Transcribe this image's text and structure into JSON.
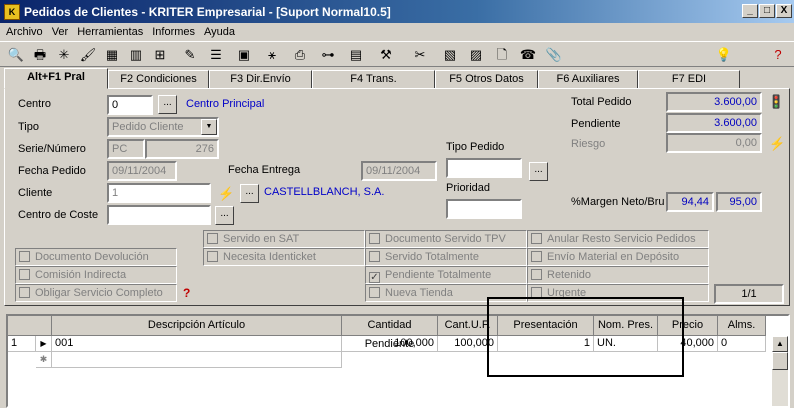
{
  "window": {
    "title": "Pedidos de Clientes - KRITER Empresarial - [Suport Normal10.5]",
    "controls": [
      "_",
      "□",
      "X"
    ]
  },
  "menu": [
    "Archivo",
    "Ver",
    "Herramientas",
    "Informes",
    "Ayuda"
  ],
  "tabs": [
    "Alt+F1 Pral",
    "F2 Condiciones",
    "F3 Dir.Envío",
    "F4 Trans.",
    "F5 Otros Datos",
    "F6 Auxiliares",
    "F7 EDI"
  ],
  "form": {
    "centro_label": "Centro",
    "centro_value": "0",
    "centro_name": "Centro Principal",
    "tipo_label": "Tipo",
    "tipo_value": "Pedido Cliente",
    "serie_label": "Serie/Número",
    "serie_value": "PC",
    "numero_value": "276",
    "fecha_pedido_label": "Fecha Pedido",
    "fecha_pedido_value": "09/11/2004",
    "fecha_entrega_label": "Fecha Entrega",
    "fecha_entrega_value": "09/11/2004",
    "tipo_pedido_label": "Tipo Pedido",
    "tipo_pedido_value": "",
    "prioridad_label": "Prioridad",
    "prioridad_value": "",
    "cliente_label": "Cliente",
    "cliente_value": "1",
    "cliente_name": "CASTELLBLANCH, S.A.",
    "centro_coste_label": "Centro de Coste",
    "centro_coste_value": "",
    "ellipsis": "...",
    "dropdown_arrow": "▼"
  },
  "totals": {
    "total_label": "Total Pedido",
    "total_value": "3.600,00",
    "pendiente_label": "Pendiente",
    "pendiente_value": "3.600,00",
    "riesgo_label": "Riesgo",
    "riesgo_value": "0,00",
    "margen_label": "%Margen Neto/Bru",
    "margen_neto": "94,44",
    "margen_bruto": "95,00"
  },
  "checkboxes": {
    "col1": [
      "Documento Devolución",
      "Comisión Indirecta",
      "Obligar Servicio Completo"
    ],
    "col2": [
      "Servido en SAT",
      "Necesita Identicket"
    ],
    "col3": [
      "Documento Servido TPV",
      "Servido Totalmente",
      "Pendiente Totalmente",
      "Nueva Tienda"
    ],
    "col3_checked": [
      false,
      false,
      true,
      false
    ],
    "col4": [
      "Anular Resto Servicio Pedidos",
      "Envío Material en Depósito",
      "Retenido",
      "Urgente"
    ],
    "check_mark": "✓"
  },
  "page_indicator": "1/1",
  "grid": {
    "headers": [
      "",
      "Descripción Artículo",
      "Cantidad Pendiente",
      "Cant.U.F.",
      "Presentación",
      "Nom. Pres.",
      "Precio",
      "Alms."
    ],
    "rows": [
      {
        "num": "1",
        "marker": "▶",
        "desc": "001",
        "cant_pend": "100,000",
        "cant_uf": "100,000",
        "pres": "1",
        "nom_pres": "UN.",
        "precio": "40,000",
        "alms": "0"
      }
    ],
    "new_row_marker": "✱"
  },
  "colors": {
    "accent": "#0a246a",
    "link": "#0000c8",
    "panel": "#d4d0c8"
  }
}
